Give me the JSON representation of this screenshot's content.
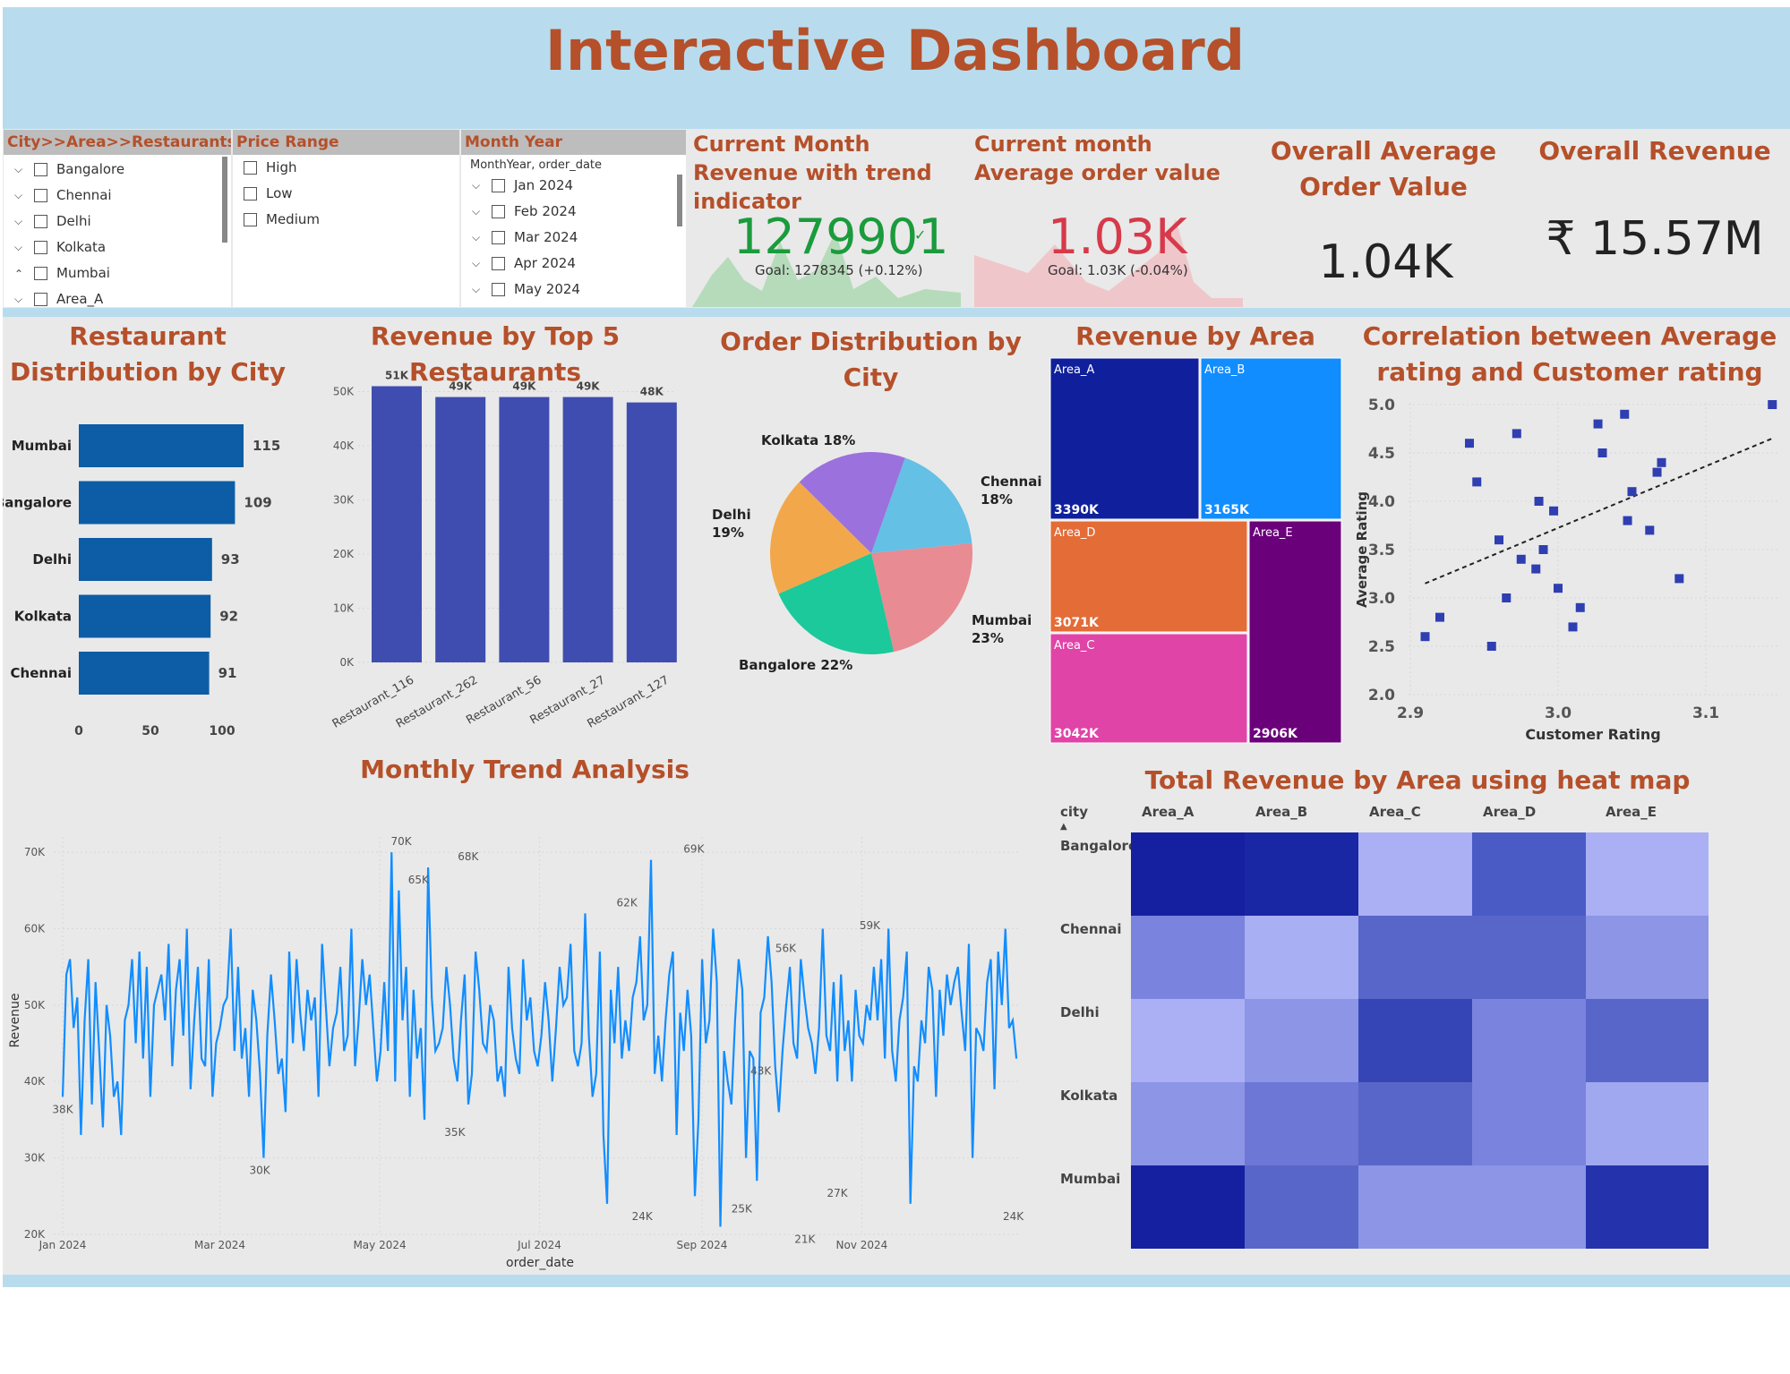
{
  "header": {
    "title": "Interactive Dashboard"
  },
  "slicers": {
    "city": {
      "title": "City>>Area>>Restaurants",
      "items": [
        {
          "label": "Bangalore",
          "chev": "⌵"
        },
        {
          "label": "Chennai",
          "chev": "⌵"
        },
        {
          "label": "Delhi",
          "chev": "⌵"
        },
        {
          "label": "Kolkata",
          "chev": "⌵"
        },
        {
          "label": "Mumbai",
          "chev": "⌃"
        },
        {
          "label": "Area_A",
          "chev": "⌵"
        }
      ]
    },
    "price": {
      "title": "Price Range",
      "items": [
        {
          "label": "High"
        },
        {
          "label": "Low"
        },
        {
          "label": "Medium"
        }
      ]
    },
    "month": {
      "title": "Month Year",
      "sub": "MonthYear, order_date",
      "items": [
        {
          "label": "Jan 2024"
        },
        {
          "label": "Feb 2024"
        },
        {
          "label": "Mar 2024"
        },
        {
          "label": "Apr 2024"
        },
        {
          "label": "May 2024"
        }
      ]
    }
  },
  "kpis": {
    "current_revenue": {
      "title": "Current Month Revenue with trend indicator",
      "value": "1279901",
      "check": "✓",
      "goal": "Goal: 1278345 (+0.12%)",
      "color": "#1a9b3c"
    },
    "current_aov": {
      "title": "Current month Average order value",
      "value": "1.03K",
      "mark": "!",
      "goal": "Goal: 1.03K (-0.04%)",
      "color": "#d63a4a"
    },
    "overall_aov": {
      "title": "Overall Average Order Value",
      "value": "1.04K"
    },
    "overall_revenue": {
      "title": "Overall Revenue",
      "value": "₹ 15.57M"
    }
  },
  "panels": {
    "restaurant_dist": {
      "title": "Restaurant Distribution by City"
    },
    "top5": {
      "title": "Revenue by Top 5 Restaurants"
    },
    "order_dist": {
      "title": "Order Distribution by City"
    },
    "revenue_area": {
      "title": "Revenue by Area"
    },
    "correlation": {
      "title": "Correlation between Average rating and Customer rating"
    },
    "monthly": {
      "title": "Monthly Trend Analysis"
    },
    "heatmap": {
      "title": "Total Revenue by Area using heat map"
    }
  },
  "chart_data": [
    {
      "id": "restaurant_dist",
      "type": "bar",
      "orientation": "horizontal",
      "categories": [
        "Mumbai",
        "Bangalore",
        "Delhi",
        "Kolkata",
        "Chennai"
      ],
      "values": [
        115,
        109,
        93,
        92,
        91
      ],
      "xlim": [
        0,
        100
      ],
      "xticks": [
        0,
        50,
        100
      ],
      "color": "#0c5da5"
    },
    {
      "id": "top5",
      "type": "bar",
      "categories": [
        "Restaurant_116",
        "Restaurant_262",
        "Restaurant_56",
        "Restaurant_27",
        "Restaurant_127"
      ],
      "values": [
        51,
        49,
        49,
        49,
        48
      ],
      "data_labels": [
        "51K",
        "49K",
        "49K",
        "49K",
        "48K"
      ],
      "ylim": [
        0,
        50
      ],
      "yticks": [
        "0K",
        "10K",
        "20K",
        "30K",
        "40K",
        "50K"
      ],
      "color": "#3f4db0"
    },
    {
      "id": "order_dist",
      "type": "pie",
      "slices": [
        {
          "label": "Chennai",
          "pct": 18,
          "color": "#64c0e4",
          "text": [
            "Chennai",
            "18%"
          ]
        },
        {
          "label": "Mumbai",
          "pct": 23,
          "color": "#e88b92",
          "text": [
            "Mumbai",
            "23%"
          ]
        },
        {
          "label": "Bangalore",
          "pct": 22,
          "color": "#1bc99a",
          "text": [
            "Bangalore 22%"
          ]
        },
        {
          "label": "Delhi",
          "pct": 19,
          "color": "#f2a84a",
          "text": [
            "Delhi",
            "19%"
          ]
        },
        {
          "label": "Kolkata",
          "pct": 18,
          "color": "#9b71dd",
          "text": [
            "Kolkata 18%"
          ]
        }
      ]
    },
    {
      "id": "revenue_area",
      "type": "treemap",
      "items": [
        {
          "name": "Area_A",
          "value": 3390,
          "label": "3390K",
          "color": "#10209c"
        },
        {
          "name": "Area_B",
          "value": 3165,
          "label": "3165K",
          "color": "#118dff"
        },
        {
          "name": "Area_D",
          "value": 3071,
          "label": "3071K",
          "color": "#e46c37"
        },
        {
          "name": "Area_C",
          "value": 3042,
          "label": "3042K",
          "color": "#e044a7"
        },
        {
          "name": "Area_E",
          "value": 2906,
          "label": "2906K",
          "color": "#6b007b"
        }
      ]
    },
    {
      "id": "correlation",
      "type": "scatter",
      "xlabel": "Customer Rating",
      "ylabel": "Average Rating",
      "xlim": [
        2.9,
        3.15
      ],
      "ylim": [
        2.0,
        5.0
      ],
      "xticks": [
        "2.9",
        "3.0",
        "3.1"
      ],
      "yticks": [
        "2.0",
        "2.5",
        "3.0",
        "3.5",
        "4.0",
        "4.5",
        "5.0"
      ],
      "points": [
        [
          2.91,
          2.6
        ],
        [
          2.92,
          2.8
        ],
        [
          2.94,
          4.6
        ],
        [
          2.945,
          4.2
        ],
        [
          2.955,
          2.5
        ],
        [
          2.96,
          3.6
        ],
        [
          2.965,
          3.0
        ],
        [
          2.972,
          4.7
        ],
        [
          2.975,
          3.4
        ],
        [
          2.985,
          3.3
        ],
        [
          2.987,
          4.0
        ],
        [
          2.99,
          3.5
        ],
        [
          2.997,
          3.9
        ],
        [
          3.0,
          3.1
        ],
        [
          3.01,
          2.7
        ],
        [
          3.015,
          2.9
        ],
        [
          3.027,
          4.8
        ],
        [
          3.03,
          4.5
        ],
        [
          3.045,
          4.9
        ],
        [
          3.047,
          3.8
        ],
        [
          3.05,
          4.1
        ],
        [
          3.062,
          3.7
        ],
        [
          3.067,
          4.3
        ],
        [
          3.07,
          4.4
        ],
        [
          3.082,
          3.2
        ],
        [
          3.145,
          5.0
        ]
      ],
      "trend": [
        [
          2.91,
          3.15
        ],
        [
          3.145,
          4.65
        ]
      ]
    },
    {
      "id": "monthly",
      "type": "line",
      "xlabel": "order_date",
      "ylabel": "Revenue",
      "ylim": [
        20,
        72
      ],
      "yticks": [
        "20K",
        "30K",
        "40K",
        "50K",
        "60K",
        "70K"
      ],
      "xticks": [
        "Jan 2024",
        "Mar 2024",
        "May 2024",
        "Jul 2024",
        "Sep 2024",
        "Nov 2024"
      ],
      "xtick_days": [
        0,
        60,
        121,
        182,
        244,
        305
      ],
      "color": "#118dff",
      "annotations": [
        [
          0,
          38,
          "38K"
        ],
        [
          103,
          30,
          "30K"
        ],
        [
          177,
          70,
          "70K"
        ],
        [
          186,
          65,
          "65K"
        ],
        [
          205,
          35,
          "35K"
        ],
        [
          212,
          68,
          "68K"
        ],
        [
          295,
          62,
          "62K"
        ],
        [
          303,
          24,
          "24K"
        ],
        [
          330,
          69,
          "69K"
        ],
        [
          355,
          25,
          "25K"
        ],
        [
          388,
          21,
          "21K"
        ],
        [
          378,
          56,
          "56K"
        ],
        [
          405,
          27,
          "27K"
        ],
        [
          422,
          59,
          "59K"
        ],
        [
          497,
          24,
          "24K"
        ],
        [
          365,
          43,
          "43K"
        ]
      ],
      "values": [
        38,
        54,
        56,
        47,
        51,
        33,
        48,
        56,
        37,
        53,
        44,
        34,
        50,
        46,
        38,
        40,
        33,
        48,
        50,
        56,
        45,
        57,
        43,
        55,
        38,
        50,
        52,
        54,
        48,
        58,
        42,
        52,
        56,
        46,
        60,
        39,
        48,
        55,
        43,
        42,
        56,
        38,
        45,
        47,
        50,
        51,
        60,
        44,
        55,
        43,
        47,
        38,
        52,
        48,
        41,
        30,
        46,
        54,
        48,
        41,
        43,
        36,
        57,
        45,
        56,
        49,
        44,
        52,
        48,
        51,
        38,
        58,
        50,
        42,
        47,
        49,
        55,
        44,
        46,
        60,
        42,
        48,
        56,
        50,
        54,
        47,
        40,
        44,
        53,
        44,
        70,
        40,
        65,
        48,
        55,
        38,
        52,
        43,
        47,
        35,
        68,
        51,
        44,
        45,
        47,
        55,
        50,
        43,
        40,
        48,
        54,
        37,
        41,
        57,
        52,
        45,
        44,
        50,
        48,
        40,
        42,
        38,
        55,
        47,
        43,
        41,
        56,
        48,
        51,
        44,
        42,
        46,
        53,
        48,
        40,
        47,
        55,
        50,
        51,
        58,
        44,
        42,
        45,
        62,
        46,
        38,
        41,
        57,
        33,
        24,
        52,
        45,
        55,
        43,
        48,
        44,
        51,
        53,
        59,
        48,
        50,
        69,
        41,
        46,
        40,
        48,
        54,
        57,
        33,
        49,
        44,
        52,
        46,
        25,
        35,
        56,
        45,
        48,
        60,
        53,
        21,
        44,
        40,
        37,
        48,
        56,
        52,
        30,
        44,
        43,
        27,
        49,
        51,
        59,
        53,
        42,
        36,
        44,
        50,
        55,
        45,
        43,
        56,
        51,
        47,
        45,
        41,
        47,
        60,
        46,
        44,
        53,
        40,
        54,
        44,
        48,
        40,
        52,
        46,
        45,
        50,
        48,
        55,
        48,
        56,
        43,
        60,
        44,
        40,
        48,
        51,
        57,
        24,
        42,
        40,
        48,
        45,
        55,
        52,
        38,
        52,
        46,
        54,
        50,
        53,
        55,
        49,
        44,
        58,
        30,
        47,
        46,
        44,
        53,
        56,
        39,
        57,
        50,
        60,
        47,
        48,
        43
      ]
    },
    {
      "id": "heatmap",
      "type": "heatmap",
      "x": [
        "Area_A",
        "Area_B",
        "Area_C",
        "Area_D",
        "Area_E"
      ],
      "y": [
        "Bangalore",
        "Chennai",
        "Delhi",
        "Kolkata",
        "Mumbai"
      ],
      "corner_label": "city",
      "colors": [
        [
          "#1520a0",
          "#1a27a5",
          "#aab0f3",
          "#4a5bc6",
          "#aab0f3"
        ],
        [
          "#7a83de",
          "#a8aff2",
          "#5866c9",
          "#5866c9",
          "#8c95e6"
        ],
        [
          "#aab0f3",
          "#8c95e6",
          "#3645b5",
          "#7a83de",
          "#5866c9"
        ],
        [
          "#8c95e6",
          "#6d77d6",
          "#5866c9",
          "#7a83de",
          "#a0a8ef"
        ],
        [
          "#1520a0",
          "#5866c9",
          "#8c95e6",
          "#8c95e6",
          "#2433ab"
        ]
      ]
    }
  ]
}
